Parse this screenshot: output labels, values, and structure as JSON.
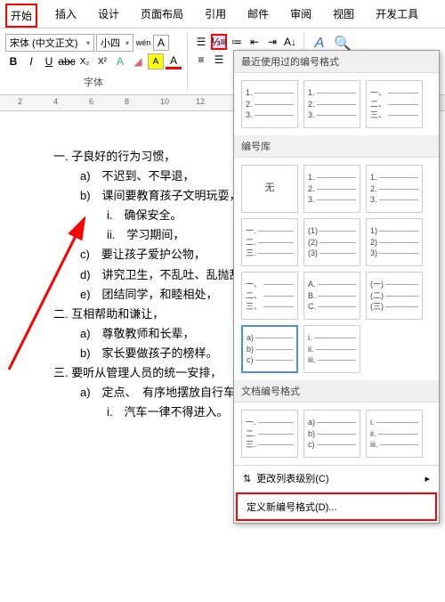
{
  "tabs": [
    "开始",
    "插入",
    "设计",
    "页面布局",
    "引用",
    "邮件",
    "审阅",
    "视图",
    "开发工具"
  ],
  "font": {
    "name": "宋体 (中文正文)",
    "size": "小四",
    "wen": "wén",
    "group_label": "字体"
  },
  "ruler_marks": [
    "2",
    "4",
    "6",
    "8",
    "10",
    "12"
  ],
  "doc": {
    "lines": [
      {
        "lvl": 1,
        "text": "一. 子良好的行为习惯，"
      },
      {
        "lvl": 2,
        "text": "a)　不迟到、不早退，"
      },
      {
        "lvl": 2,
        "text": "b)　课间要教育孩子文明玩耍，"
      },
      {
        "lvl": 3,
        "text": "i.　确保安全。"
      },
      {
        "lvl": 3,
        "text": "ii.　学习期间，"
      },
      {
        "lvl": 2,
        "text": "c)　要让孩子爱护公物，"
      },
      {
        "lvl": 2,
        "text": "d)　讲究卫生，不乱吐、乱抛乱"
      },
      {
        "lvl": 2,
        "text": "e)　团结同学，和睦相处，"
      },
      {
        "lvl": 1,
        "text": "二. 互相帮助和谦让，"
      },
      {
        "lvl": 2,
        "text": "a)　尊敬教师和长辈，"
      },
      {
        "lvl": 2,
        "text": "b)　家长要做孩子的榜样。"
      },
      {
        "lvl": 1,
        "text": "三. 要听从管理人员的统一安排，"
      },
      {
        "lvl": 2,
        "text": "a)　定点、　有序地摆放自行车"
      },
      {
        "lvl": 3,
        "text": "i.　汽车一律不得进入。"
      }
    ]
  },
  "dropdown": {
    "section1": "最近使用过的编号格式",
    "section2": "编号库",
    "section3": "文档编号格式",
    "none_label": "无",
    "recent": [
      [
        "1.",
        "2.",
        "3."
      ],
      [
        "1.",
        "2.",
        "3."
      ],
      [
        "一、",
        "二、",
        "三、"
      ]
    ],
    "library": [
      null,
      [
        "1.",
        "2.",
        "3."
      ],
      [
        "1.",
        "2.",
        "3."
      ],
      [
        "一.",
        "二.",
        "三."
      ],
      [
        "(1)",
        "(2)",
        "(3)"
      ],
      [
        "1)",
        "2)",
        "3)"
      ],
      [
        "一、",
        "二、",
        "三、"
      ],
      [
        "A.",
        "B.",
        "C."
      ],
      [
        "(一)",
        "(二)",
        "(三)"
      ],
      [
        "a)",
        "b)",
        "c)"
      ],
      [
        "i.",
        "ii.",
        "iii."
      ]
    ],
    "selected_index": 9,
    "doc_formats": [
      [
        "一.",
        "二.",
        "三."
      ],
      [
        "a)",
        "b)",
        "c)"
      ],
      [
        "i.",
        "ii.",
        "iii."
      ]
    ],
    "footer": {
      "change_level": "更改列表级别(C)",
      "define_new": "定义新编号格式(D)..."
    }
  }
}
